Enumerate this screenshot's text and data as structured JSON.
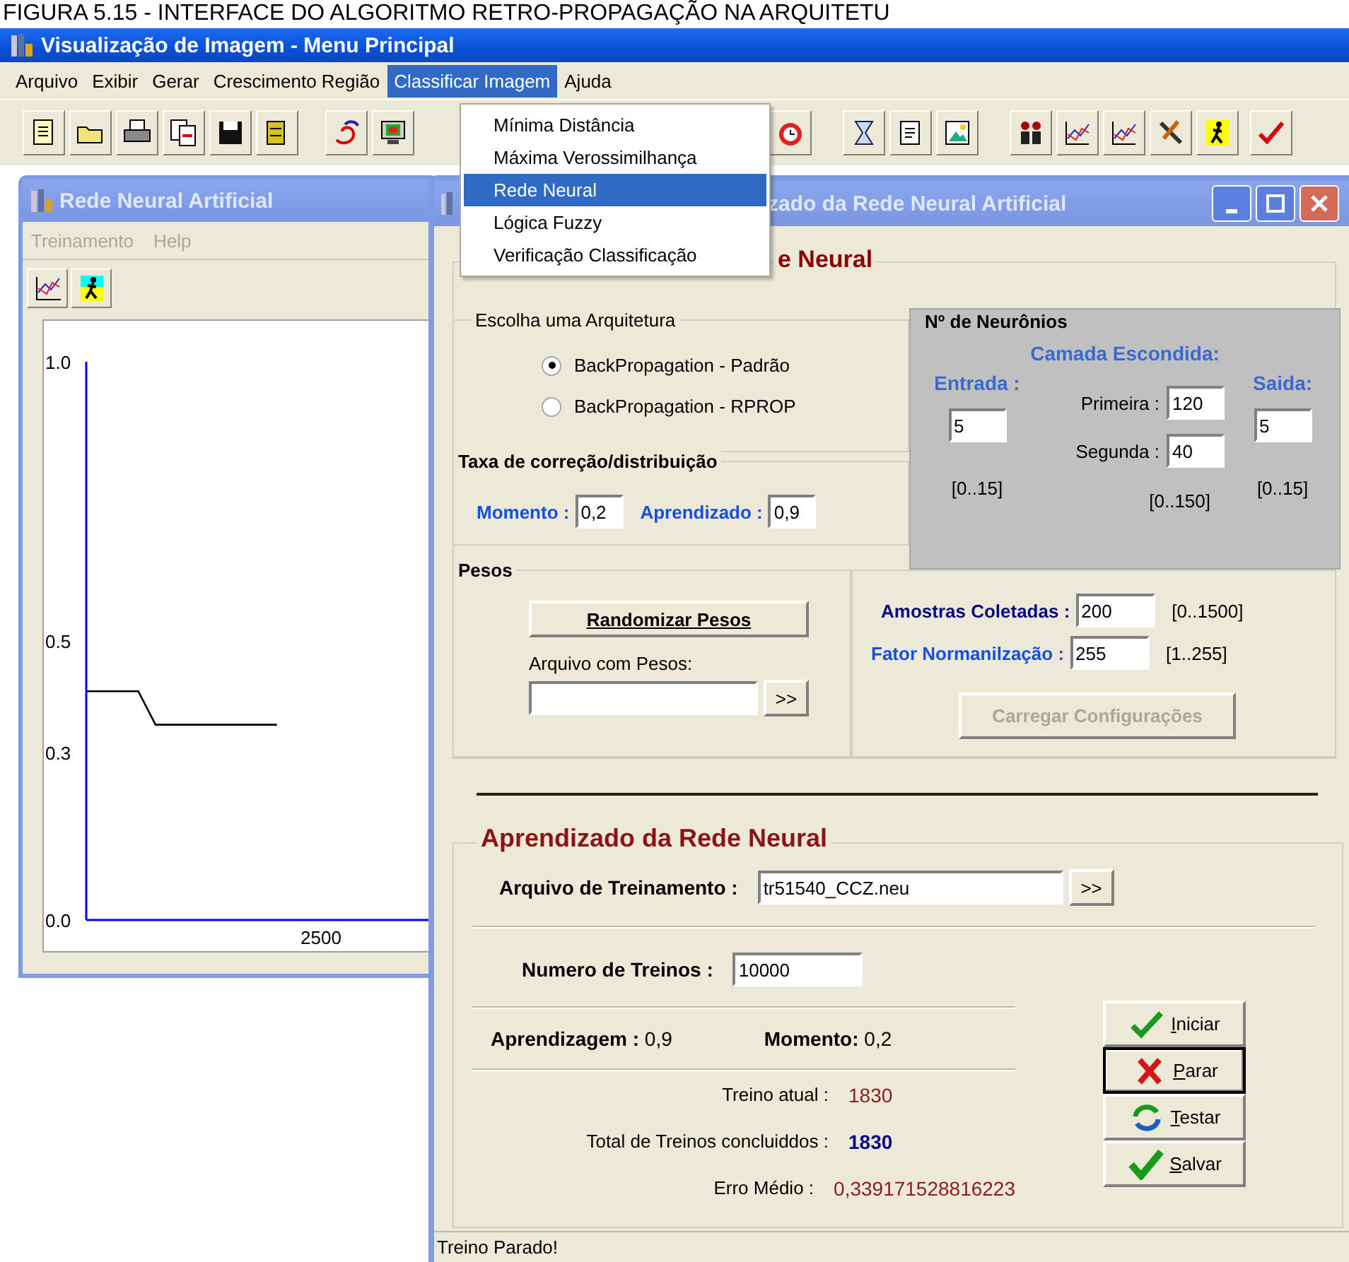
{
  "caption": "FIGURA 5.15 - INTERFACE DO ALGORITMO RETRO-PROPAGAÇÃO NA ARQUITETU",
  "main_window": {
    "title": "Visualização de Imagem - Menu Principal",
    "menu": [
      {
        "label": "Arquivo",
        "selected": false
      },
      {
        "label": "Exibir",
        "selected": false
      },
      {
        "label": "Gerar",
        "selected": false
      },
      {
        "label": "Crescimento Região",
        "selected": false
      },
      {
        "label": "Classificar Imagem",
        "selected": true
      },
      {
        "label": "Ajuda",
        "selected": false
      }
    ]
  },
  "dropdown": {
    "items": [
      {
        "label": "Mínima Distância",
        "selected": false
      },
      {
        "label": "Máxima Verossimilhança",
        "selected": false
      },
      {
        "label": "Rede Neural",
        "selected": true
      },
      {
        "label": "Lógica Fuzzy",
        "selected": false
      },
      {
        "label": "Verificação Classificação",
        "selected": false
      }
    ]
  },
  "chart_window": {
    "title": "Rede Neural Artificial",
    "menu": [
      {
        "label": "Treinamento",
        "disabled": true
      },
      {
        "label": "Help",
        "disabled": true
      }
    ],
    "chart_data": {
      "type": "line",
      "series": [
        {
          "color": "#000000",
          "values": [
            0.41,
            0.41,
            0.41,
            0.41,
            0.35,
            0.35,
            0.35,
            0.35,
            0.35,
            0.35,
            0.35,
            0.35,
            null,
            null,
            null,
            null,
            null,
            null,
            null,
            null,
            null
          ]
        }
      ],
      "annotations": [
        "2500"
      ],
      "ylim": [
        0,
        1
      ],
      "yticks": [
        {
          "value": 1,
          "label": "1.0"
        },
        {
          "value": 0.5,
          "label": "0.5"
        },
        {
          "value": 0.3,
          "label": "0.3"
        },
        {
          "value": 0,
          "label": "0.0"
        }
      ]
    }
  },
  "config_window": {
    "title": "zado da Rede Neural Artificial",
    "group_title": "e Neural",
    "architecture": {
      "title": "Escolha uma Arquitetura",
      "options": [
        {
          "label": "BackPropagation - Padrão",
          "selected": true
        },
        {
          "label": "BackPropagation - RPROP",
          "selected": false
        }
      ]
    },
    "rates": {
      "title": "Taxa de correção/distribuição",
      "momento_label": "Momento :",
      "momento": "0,2",
      "aprendizado_label": "Aprendizado :",
      "aprendizado": "0,9"
    },
    "neurons": {
      "title": "Nº de Neurônios",
      "hidden_label": "Camada Escondida:",
      "input_label": "Entrada :",
      "input": "5",
      "input_range": "[0..15]",
      "first_label": "Primeira :",
      "first": "120",
      "second_label": "Segunda :",
      "second": "40",
      "hidden_range": "[0..150]",
      "output_label": "Saida:",
      "output": "5",
      "output_range": "[0..15]"
    },
    "weights": {
      "title": "Pesos",
      "randomize_button": "Randomizar Pesos",
      "file_label": "Arquivo com Pesos:",
      "browse": ">>"
    },
    "samples": {
      "samples_label": "Amostras Coletadas :",
      "samples": "200",
      "samples_range": "[0..1500]",
      "norm_label": "Fator Normanilzação :",
      "norm": "255",
      "norm_range": "[1..255]",
      "load_button": {
        "label": "Carregar Configurações",
        "disabled": true
      }
    },
    "training": {
      "title": "Aprendizado da Rede Neural",
      "file_label": "Arquivo de Treinamento :",
      "file": "tr51540_CCZ.neu",
      "browse": ">>",
      "count_label": "Numero de Treinos :",
      "count": "10000",
      "rate_label": "Aprendizagem :",
      "rate": "0,9",
      "momentum_label": "Momento:",
      "momentum": "0,2",
      "stats": [
        {
          "label": "Treino  atual :",
          "value": "1830",
          "kind": "current"
        },
        {
          "label": "Total de Treinos concluiddos :",
          "value": "1830",
          "kind": "total"
        },
        {
          "label": "Erro Médio :",
          "value": "0,339171528816223",
          "kind": "error"
        }
      ],
      "buttons": [
        {
          "label": "Iniciar",
          "kind": "start",
          "focused": false
        },
        {
          "label": "Parar",
          "kind": "stop",
          "focused": true
        },
        {
          "label": "Testar",
          "kind": "test",
          "focused": false
        },
        {
          "label": "Salvar",
          "kind": "save",
          "focused": false
        }
      ]
    },
    "status": "Treino Parado!"
  }
}
